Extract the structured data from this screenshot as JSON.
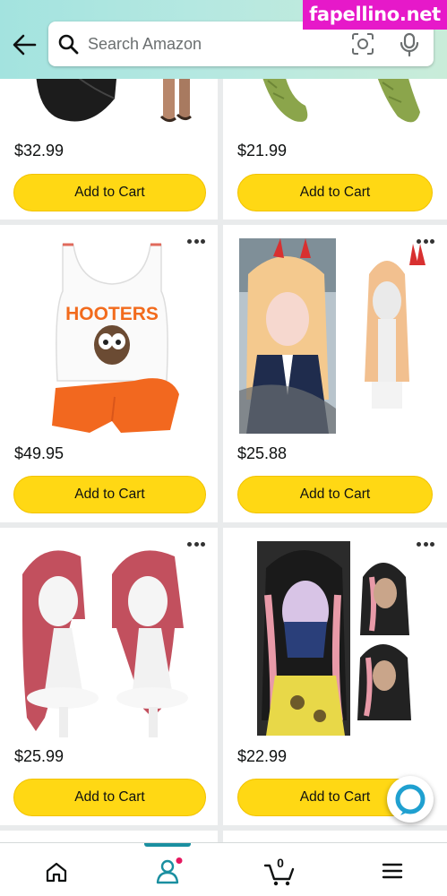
{
  "header": {
    "search_placeholder": "Search Amazon"
  },
  "watermark": "fapellino.net",
  "products": [
    {
      "price": "$32.99",
      "button": "Add to Cart"
    },
    {
      "price": "$21.99",
      "button": "Add to Cart"
    },
    {
      "price": "$49.95",
      "button": "Add to Cart",
      "image_text": "HOOTERS"
    },
    {
      "price": "$25.88",
      "button": "Add to Cart"
    },
    {
      "price": "$25.99",
      "button": "Add to Cart"
    },
    {
      "price": "$22.99",
      "button": "Add to Cart"
    }
  ],
  "nav": {
    "cart_count": "0",
    "items": [
      "home-icon",
      "account-icon",
      "cart-icon",
      "menu-icon"
    ]
  },
  "colors": {
    "add_to_cart": "#ffd814",
    "nav_active": "#1a8fa0",
    "watermark_bg": "#e619c9"
  }
}
